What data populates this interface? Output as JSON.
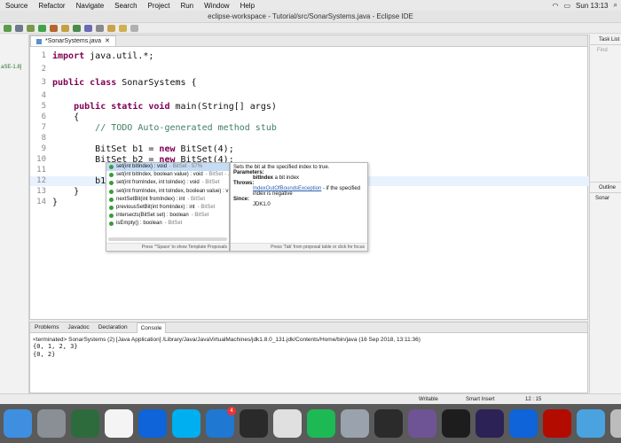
{
  "menubar": {
    "items": [
      "Source",
      "Refactor",
      "Navigate",
      "Search",
      "Project",
      "Run",
      "Window",
      "Help"
    ],
    "clock": "Sun 13:13"
  },
  "window": {
    "title": "eclipse-workspace - Tutorial/src/SonarSystems.java - Eclipse IDE"
  },
  "left_strip": {
    "jre_label": "aSE-1.8]"
  },
  "editor": {
    "tab_label": "*SonarSystems.java",
    "lines": [
      {
        "n": "1",
        "segs": [
          {
            "t": "import",
            "k": "kw"
          },
          {
            "t": " java.util.*;",
            "k": ""
          }
        ]
      },
      {
        "n": "2",
        "segs": []
      },
      {
        "n": "3",
        "segs": [
          {
            "t": "public class",
            "k": "kw"
          },
          {
            "t": " SonarSystems {",
            "k": ""
          }
        ]
      },
      {
        "n": "4",
        "segs": []
      },
      {
        "n": "5",
        "segs": [
          {
            "t": "    ",
            "k": ""
          },
          {
            "t": "public static void",
            "k": "kw"
          },
          {
            "t": " main(String[] args)",
            "k": ""
          }
        ]
      },
      {
        "n": "6",
        "segs": [
          {
            "t": "    {",
            "k": ""
          }
        ]
      },
      {
        "n": "7",
        "segs": [
          {
            "t": "        ",
            "k": ""
          },
          {
            "t": "// TODO Auto-generated method stub",
            "k": "cm"
          }
        ]
      },
      {
        "n": "8",
        "segs": []
      },
      {
        "n": "9",
        "segs": [
          {
            "t": "        BitSet b1 = ",
            "k": ""
          },
          {
            "t": "new",
            "k": "kw"
          },
          {
            "t": " BitSet(4);",
            "k": ""
          }
        ]
      },
      {
        "n": "10",
        "segs": [
          {
            "t": "        BitSet b2 = ",
            "k": ""
          },
          {
            "t": "new",
            "k": "kw"
          },
          {
            "t": " BitSet(4);",
            "k": ""
          }
        ]
      },
      {
        "n": "11",
        "segs": []
      },
      {
        "n": "12",
        "segs": [
          {
            "t": "        b1.set",
            "k": ""
          }
        ]
      },
      {
        "n": "13",
        "segs": [
          {
            "t": "    }",
            "k": ""
          }
        ]
      },
      {
        "n": "14",
        "segs": [
          {
            "t": "}",
            "k": ""
          }
        ]
      }
    ]
  },
  "content_assist": {
    "proposals": [
      {
        "main": "set(int bitIndex) : void",
        "rest": " - BitSet - 57%"
      },
      {
        "main": "set(int bitIndex, boolean value) : void",
        "rest": " - BitSet - ..."
      },
      {
        "main": "set(int fromIndex, int toIndex) : void",
        "rest": " - BitSet"
      },
      {
        "main": "set(int fromIndex, int toIndex, boolean value) : v",
        "rest": ""
      },
      {
        "main": "nextSetBit(int fromIndex) : int",
        "rest": " - BitSet"
      },
      {
        "main": "previousSetBit(int fromIndex) : int",
        "rest": " - BitSet"
      },
      {
        "main": "intersects(BitSet set) : boolean",
        "rest": " - BitSet"
      },
      {
        "main": "isEmpty() : boolean",
        "rest": " - BitSet"
      }
    ],
    "footer": "Press '^Space' to show Template Proposals",
    "doc": {
      "summary": "Sets the bit at the specified index to true.",
      "params_title": "Parameters:",
      "param_name": "bitIndex",
      "param_desc": " a bit index",
      "throws_title": "Throws:",
      "exception": "IndexOutOfBoundsException",
      "exception_desc": " - if the specified index is negative",
      "since_title": "Since:",
      "since": "JDK1.0",
      "footer": "Press 'Tab' from proposal table or click for focus"
    }
  },
  "right_panel": {
    "tasklist": "Task List",
    "find": "Find",
    "outline": "Outline",
    "outline_item": "Sonar"
  },
  "console": {
    "tabs": [
      "Problems",
      "Javadoc",
      "Declaration",
      "Console"
    ],
    "terminated": "<terminated> SonarSystems (2) [Java Application] /Library/Java/JavaVirtualMachines/jdk1.8.0_131.jdk/Contents/Home/bin/java (16 Sep 2018, 13:11:36)",
    "output": [
      "{0, 1, 2, 3}",
      "{0, 2}"
    ]
  },
  "status": {
    "writable": "Writable",
    "insert": "Smart Insert",
    "position": "12 : 15"
  },
  "dock": {
    "apps": [
      {
        "name": "finder",
        "color": "#3f8fe0"
      },
      {
        "name": "launchpad",
        "color": "#8a8f96"
      },
      {
        "name": "mission-control",
        "color": "#2d6b3c"
      },
      {
        "name": "slack",
        "color": "#f4f4f4"
      },
      {
        "name": "teamviewer",
        "color": "#0e64d8"
      },
      {
        "name": "skype",
        "color": "#00aff0"
      },
      {
        "name": "xcode",
        "color": "#1f78d1"
      },
      {
        "name": "remote-desktop",
        "color": "#2a2a2a"
      },
      {
        "name": "chrome",
        "color": "#e0e0e0"
      },
      {
        "name": "spotify",
        "color": "#1db954"
      },
      {
        "name": "settings",
        "color": "#9aa3ad"
      },
      {
        "name": "obs",
        "color": "#2b2b2b"
      },
      {
        "name": "github",
        "color": "#6e5494"
      },
      {
        "name": "terminal",
        "color": "#1d1d1d"
      },
      {
        "name": "eclipse",
        "color": "#2c2255"
      },
      {
        "name": "teamviewer-2",
        "color": "#0e64d8"
      },
      {
        "name": "acrobat",
        "color": "#b30b00"
      },
      {
        "name": "folder",
        "color": "#4aa3df"
      },
      {
        "name": "trash",
        "color": "#bcbcbc"
      }
    ],
    "badge": "4"
  },
  "colors": {
    "keyword": "#7f0055",
    "comment": "#3f7f5f",
    "current_line": "#e8f2fe",
    "selection": "#c6dcf5"
  }
}
